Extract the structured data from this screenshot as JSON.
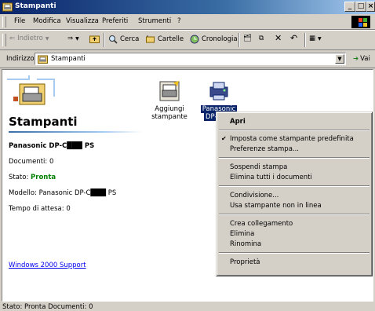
{
  "window": {
    "title": "Stampanti"
  },
  "menubar": {
    "items": [
      "File",
      "Modifica",
      "Visualizza",
      "Preferiti",
      "Strumenti",
      "?"
    ]
  },
  "toolbar": {
    "back_label": "Indietro",
    "search_label": "Cerca",
    "folders_label": "Cartelle",
    "history_label": "Cronologia"
  },
  "address": {
    "label": "Indirizzo",
    "value": "Stampanti",
    "go_label": "Vai"
  },
  "panel": {
    "title": "Stampanti",
    "printer_name": "Panasonic DP-C███ PS",
    "documents": "Documenti: 0",
    "status_label": "Stato:",
    "status_value": "Pronta",
    "model": "Modello: Panasonic DP-C███ PS",
    "wait_time": "Tempo di attesa: 0",
    "support_link": "Windows 2000 Support"
  },
  "icons": {
    "add_printer_line1": "Aggiungi",
    "add_printer_line2": "stampante",
    "printer_line1": "Panasonic",
    "printer_line2": "DP-C"
  },
  "context_menu": {
    "items": [
      "Apri",
      "Imposta come stampante predefinita",
      "Preferenze stampa...",
      "Sospendi stampa",
      "Elimina tutti i documenti",
      "Condivisione...",
      "Usa stampante non in linea",
      "Crea collegamento",
      "Elimina",
      "Rinomina",
      "Proprietà"
    ]
  },
  "statusbar": {
    "text": "Stato: Pronta Documenti: 0"
  },
  "colors": {
    "title_bar": "#0a246a",
    "selection": "#0a246a",
    "status_ready": "#008000",
    "link": "#0000ee"
  }
}
